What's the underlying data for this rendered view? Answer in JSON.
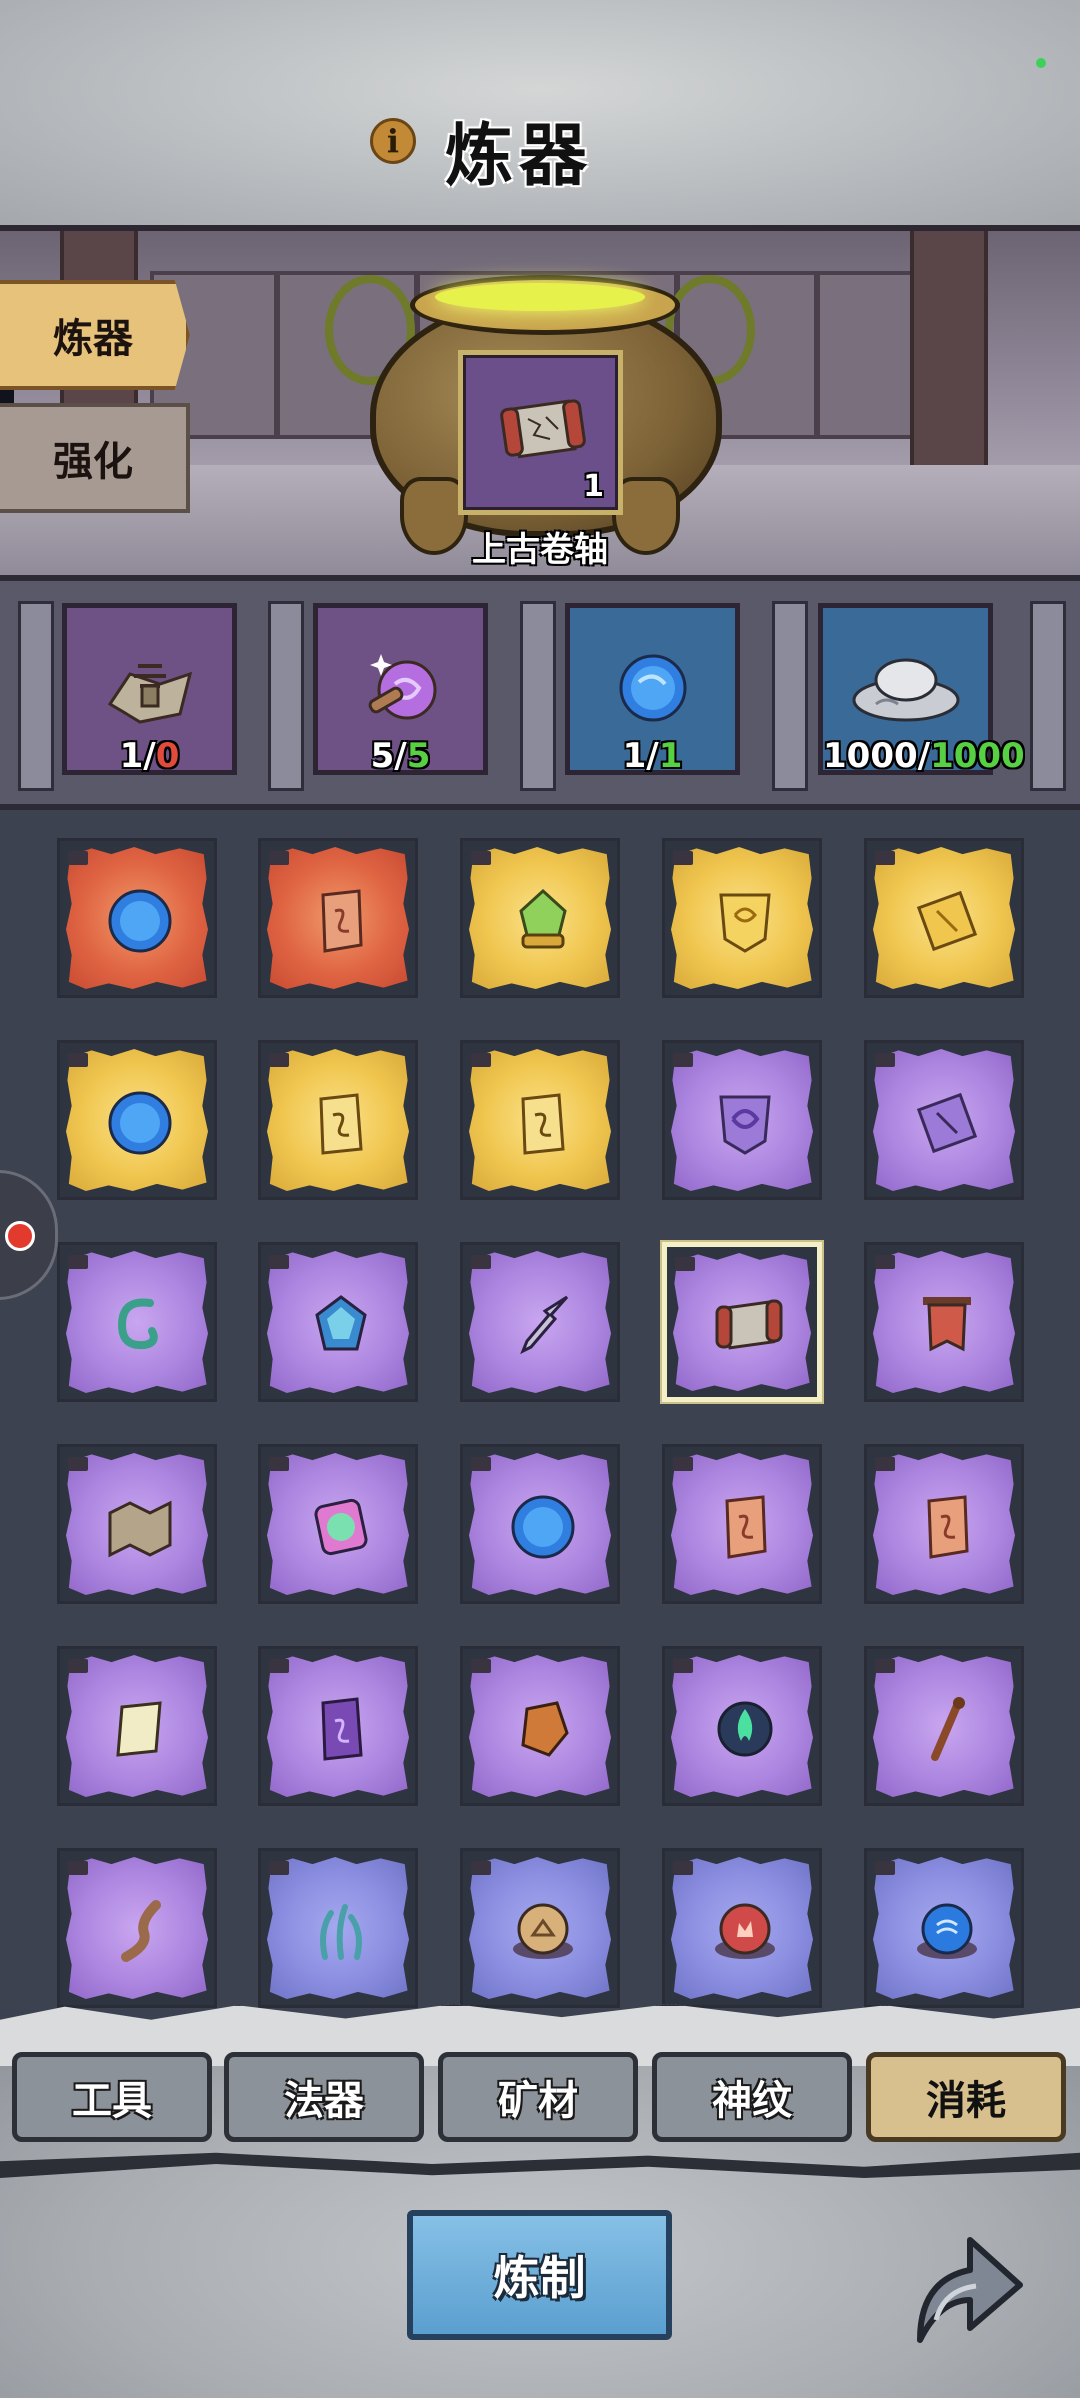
{
  "header": {
    "title": "炼器",
    "info_icon": "info-icon"
  },
  "side_tabs": [
    {
      "label": "炼器",
      "active": true
    },
    {
      "label": "强化",
      "active": false
    }
  ],
  "target": {
    "name": "上古卷轴",
    "count": "1",
    "icon": "ancient-scroll-icon"
  },
  "materials": [
    {
      "icon": "pagoda-map-icon",
      "have": "1",
      "need": "0",
      "need_color": "#e04b3c",
      "bg": "purple"
    },
    {
      "icon": "purple-orb-staff-icon",
      "have": "5",
      "need": "5",
      "need_color": "#58d043",
      "bg": "purple"
    },
    {
      "icon": "blue-orb-icon",
      "have": "1",
      "need": "1",
      "need_color": "#58d043",
      "bg": "blue"
    },
    {
      "icon": "silver-ingot-icon",
      "have": "1000",
      "need": "1000",
      "need_color": "#58d043",
      "bg": "blue"
    }
  ],
  "grid_items": [
    {
      "icon": "blue-orb-icon",
      "rarity": "red"
    },
    {
      "icon": "red-scroll-icon",
      "rarity": "red"
    },
    {
      "icon": "green-gem-icon",
      "rarity": "gold"
    },
    {
      "icon": "gold-shield-talisman-icon",
      "rarity": "gold"
    },
    {
      "icon": "gold-tag-talisman-icon",
      "rarity": "gold"
    },
    {
      "icon": "blue-orb-icon",
      "rarity": "gold"
    },
    {
      "icon": "scroll-icon",
      "rarity": "gold"
    },
    {
      "icon": "scroll-icon",
      "rarity": "gold"
    },
    {
      "icon": "shield-talisman-icon",
      "rarity": "violet"
    },
    {
      "icon": "tag-talisman-icon",
      "rarity": "violet"
    },
    {
      "icon": "hook-icon",
      "rarity": "violet"
    },
    {
      "icon": "gem-amulet-icon",
      "rarity": "violet"
    },
    {
      "icon": "dagger-icon",
      "rarity": "violet"
    },
    {
      "icon": "ancient-scroll-icon",
      "rarity": "violet",
      "selected": true
    },
    {
      "icon": "banner-icon",
      "rarity": "violet"
    },
    {
      "icon": "map-icon",
      "rarity": "violet"
    },
    {
      "icon": "rainbow-gem-icon",
      "rarity": "violet"
    },
    {
      "icon": "blue-orb-icon",
      "rarity": "violet"
    },
    {
      "icon": "red-scroll-icon",
      "rarity": "violet"
    },
    {
      "icon": "red-scroll-icon",
      "rarity": "violet"
    },
    {
      "icon": "paper-icon",
      "rarity": "violet"
    },
    {
      "icon": "purple-scroll-icon",
      "rarity": "violet"
    },
    {
      "icon": "ore-icon",
      "rarity": "violet"
    },
    {
      "icon": "green-flame-icon",
      "rarity": "violet"
    },
    {
      "icon": "staff-icon",
      "rarity": "violet"
    },
    {
      "icon": "root-icon",
      "rarity": "violet"
    },
    {
      "icon": "seaweed-icon",
      "rarity": "blueviolet"
    },
    {
      "icon": "earth-element-icon",
      "rarity": "blueviolet"
    },
    {
      "icon": "fire-element-icon",
      "rarity": "blueviolet"
    },
    {
      "icon": "water-element-icon",
      "rarity": "blueviolet"
    }
  ],
  "category_tabs": [
    {
      "label": "工具",
      "active": false
    },
    {
      "label": "法器",
      "active": false
    },
    {
      "label": "矿材",
      "active": false
    },
    {
      "label": "神纹",
      "active": false
    },
    {
      "label": "消耗",
      "active": true
    }
  ],
  "actions": {
    "craft_label": "炼制",
    "share_icon": "share-arrow-icon"
  }
}
